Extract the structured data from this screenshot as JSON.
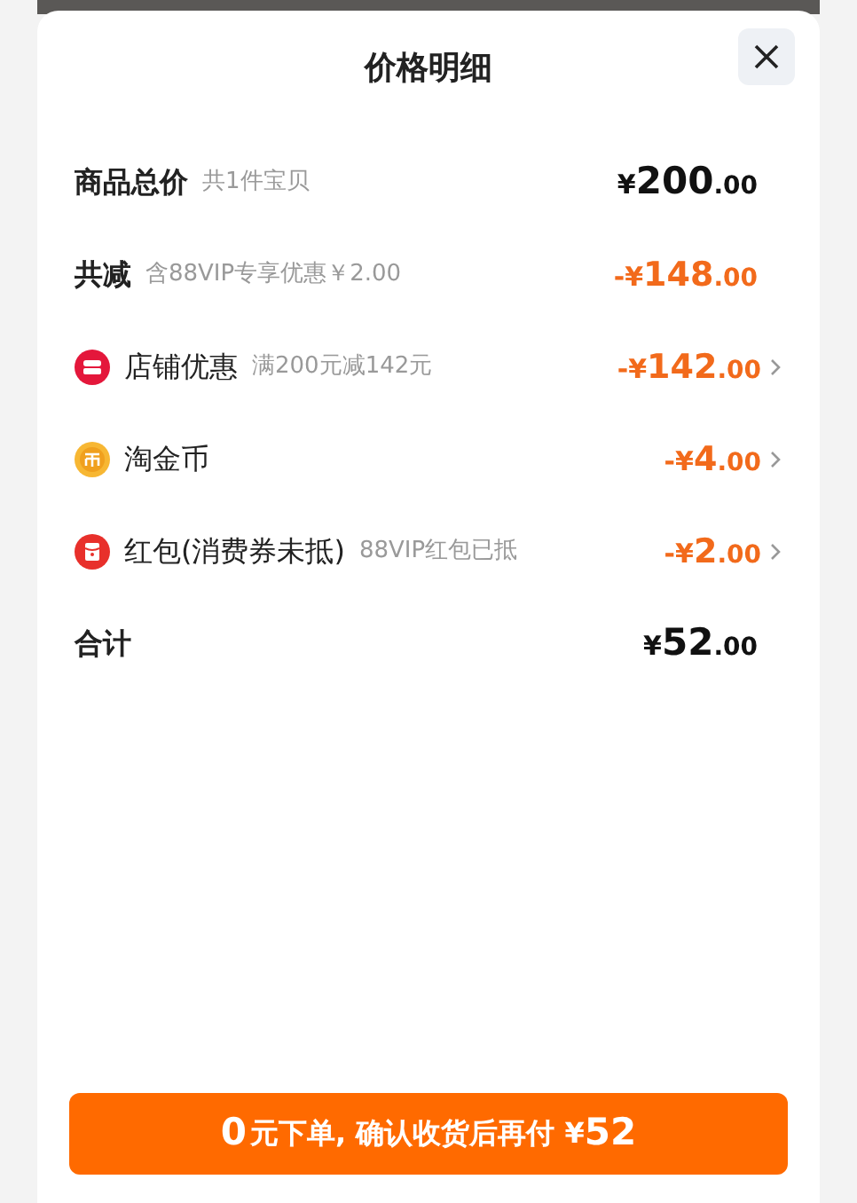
{
  "title": "价格明细",
  "rows": [
    {
      "kind": "summary",
      "label": "商品总价",
      "note": "共1件宝贝",
      "amount": {
        "prefix": "¥",
        "integer": "200",
        "decimal": ".00"
      }
    },
    {
      "kind": "reduction",
      "label": "共减",
      "note": "含88VIP专享优惠￥2.00",
      "amount": {
        "prefix": "-¥",
        "integer": "148",
        "decimal": ".00"
      }
    },
    {
      "kind": "store",
      "label": "店铺优惠",
      "note": "满200元减142元",
      "amount": {
        "prefix": "-¥",
        "integer": "142",
        "decimal": ".00"
      }
    },
    {
      "kind": "coin",
      "label": "淘金币",
      "amount": {
        "prefix": "-¥",
        "integer": "4",
        "decimal": ".00"
      }
    },
    {
      "kind": "red_packet",
      "label": "红包(消费券未抵)",
      "note": "88VIP红包已抵",
      "amount": {
        "prefix": "-¥",
        "integer": "2",
        "decimal": ".00"
      }
    },
    {
      "kind": "total",
      "label": "合计",
      "amount": {
        "prefix": "¥",
        "integer": "52",
        "decimal": ".00"
      }
    }
  ],
  "button": {
    "lead": "0",
    "middle": "元下单, 确认收货后再付 ¥",
    "tail": "52"
  }
}
